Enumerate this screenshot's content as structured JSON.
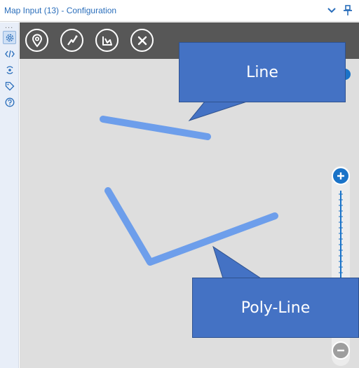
{
  "window": {
    "title": "Map Input (13) - Configuration",
    "chevron_icon": "chevron-down-icon",
    "pin_icon": "pin-icon"
  },
  "rail": {
    "dots": "...",
    "items": [
      {
        "name": "settings",
        "icon": "gear-icon",
        "active": true
      },
      {
        "name": "xml",
        "icon": "code-icon",
        "active": false
      },
      {
        "name": "connection",
        "icon": "connection-icon",
        "active": false
      },
      {
        "name": "annotation",
        "icon": "tag-icon",
        "active": false
      },
      {
        "name": "help",
        "icon": "question-icon",
        "active": false
      }
    ]
  },
  "toolbar": {
    "tools": [
      {
        "name": "point",
        "icon": "map-pin-icon"
      },
      {
        "name": "line",
        "icon": "line-draw-icon"
      },
      {
        "name": "polygon",
        "icon": "polygon-draw-icon"
      },
      {
        "name": "delete",
        "icon": "close-icon"
      }
    ]
  },
  "callouts": {
    "line_label": "Line",
    "polyline_label": "Poly-Line"
  },
  "colors": {
    "accent": "#1a73c8",
    "toolbar_bg": "#575757",
    "map_bg": "#dedede",
    "shape_stroke": "#6d9eeb",
    "callout_fill": "#4472c4"
  }
}
